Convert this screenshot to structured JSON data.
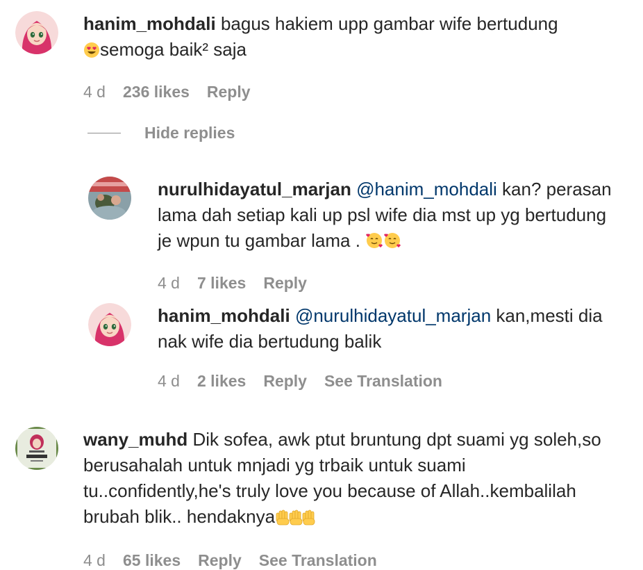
{
  "comments": [
    {
      "username": "hanim_mohdali",
      "text_before_emoji": "bagus hakiem upp gambar wife bertudung",
      "emoji": "heart-eyes-emoji",
      "text_after_emoji": "semoga baik² saja",
      "time": "4 d",
      "likes": "236 likes",
      "reply": "Reply"
    },
    {
      "username": "wany_muhd",
      "text": "Dik sofea, awk ptut bruntung dpt suami yg soleh,so berusahalah untuk mnjadi yg trbaik untuk suami tu..confidently,he's truly love you because of Allah..kembalilah brubah blik.. hendaknya",
      "emoji": "raised-hands-emoji",
      "time": "4 d",
      "likes": "65 likes",
      "reply": "Reply",
      "translate": "See Translation"
    }
  ],
  "hide_replies": "Hide replies",
  "replies": [
    {
      "username": "nurulhidayatul_marjan",
      "mention": "@hanim_mohdali",
      "text": "kan? perasan lama dah setiap kali up psl wife dia mst up yg bertudung je wpun tu gambar lama .",
      "emoji": "smiling-face-hearts-emoji",
      "time": "4 d",
      "likes": "7 likes",
      "reply": "Reply"
    },
    {
      "username": "hanim_mohdali",
      "mention": "@nurulhidayatul_marjan",
      "text": "kan,mesti dia nak wife dia bertudung balik",
      "time": "4 d",
      "likes": "2 likes",
      "reply": "Reply",
      "translate": "See Translation"
    }
  ],
  "colors": {
    "text": "#262626",
    "meta": "#8e8e8e",
    "mention": "#00376b"
  }
}
